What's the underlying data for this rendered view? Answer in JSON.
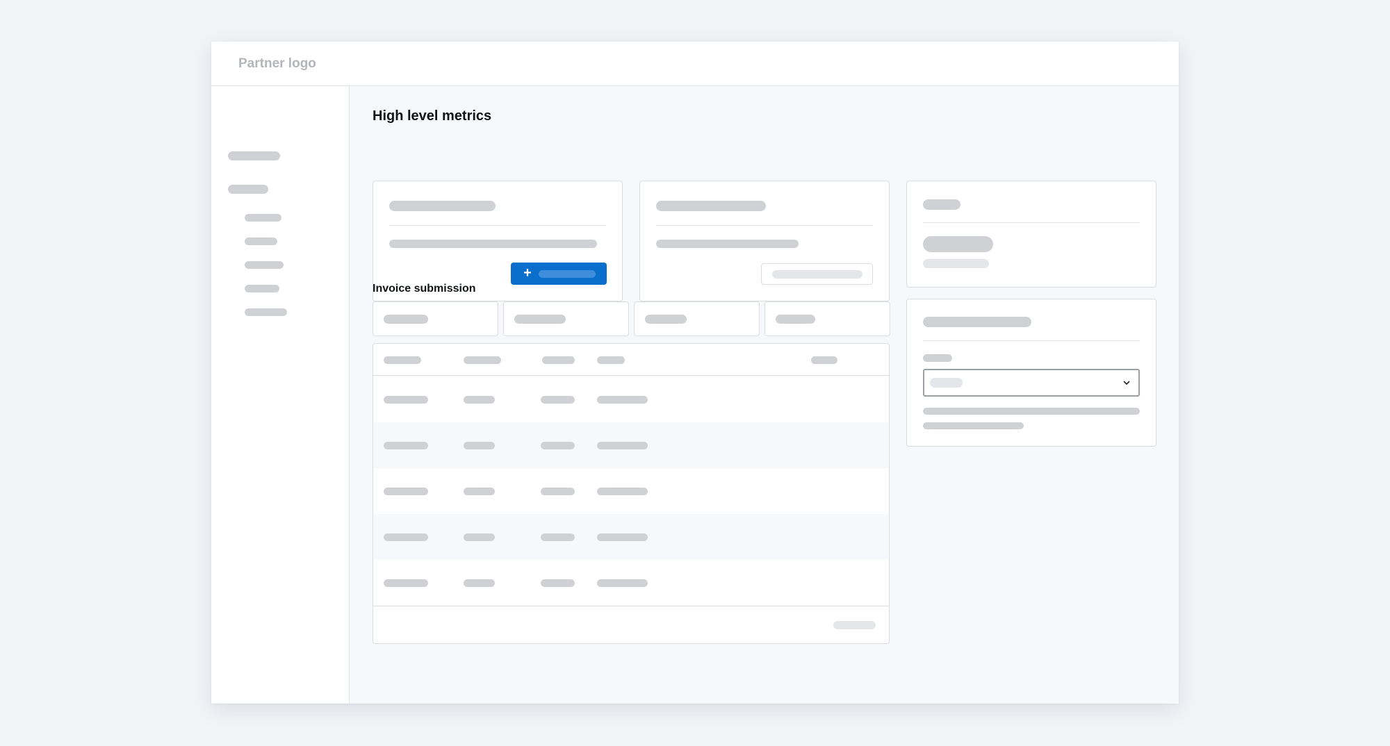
{
  "header": {
    "logo_text": "Partner logo"
  },
  "main": {
    "title": "High level metrics",
    "invoice_section_title": "Invoice submission",
    "primary_button_icon": "plus-icon",
    "select_icon": "chevron-down-icon"
  },
  "colors": {
    "primary": "#0a6fcc",
    "skeleton": "#cfd1d4",
    "page_background": "#f2f4f8"
  }
}
